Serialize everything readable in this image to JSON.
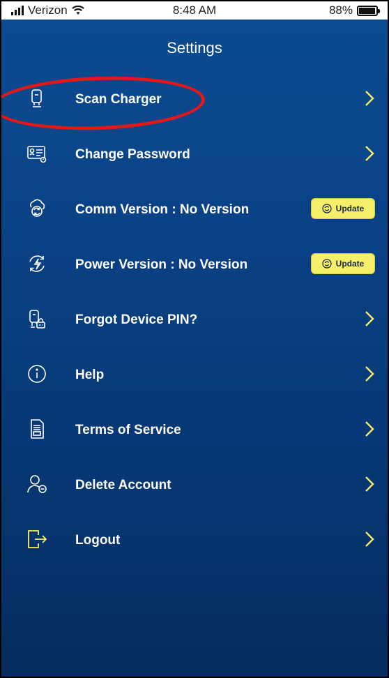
{
  "status_bar": {
    "carrier": "Verizon",
    "time": "8:48 AM",
    "battery": "88%"
  },
  "header": {
    "title": "Settings"
  },
  "menu": {
    "items": [
      {
        "label": "Scan Charger",
        "icon": "charger-icon",
        "action": "chevron"
      },
      {
        "label": "Change Password",
        "icon": "id-card-icon",
        "action": "chevron"
      },
      {
        "label": "Comm Version : No Version",
        "icon": "cloud-sync-icon",
        "action": "update"
      },
      {
        "label": "Power Version : No Version",
        "icon": "power-sync-icon",
        "action": "update"
      },
      {
        "label": "Forgot Device PIN?",
        "icon": "charger-lock-icon",
        "action": "chevron"
      },
      {
        "label": "Help",
        "icon": "info-icon",
        "action": "chevron"
      },
      {
        "label": "Terms of Service",
        "icon": "document-icon",
        "action": "chevron"
      },
      {
        "label": "Delete Account",
        "icon": "user-remove-icon",
        "action": "chevron"
      },
      {
        "label": "Logout",
        "icon": "logout-icon",
        "action": "chevron"
      }
    ],
    "update_label": "Update"
  },
  "colors": {
    "background_top": "#0d4c92",
    "background_bottom": "#052b5e",
    "text": "#ffffff",
    "accent_yellow": "#f6ef6a",
    "annotation_red": "#e01818"
  }
}
